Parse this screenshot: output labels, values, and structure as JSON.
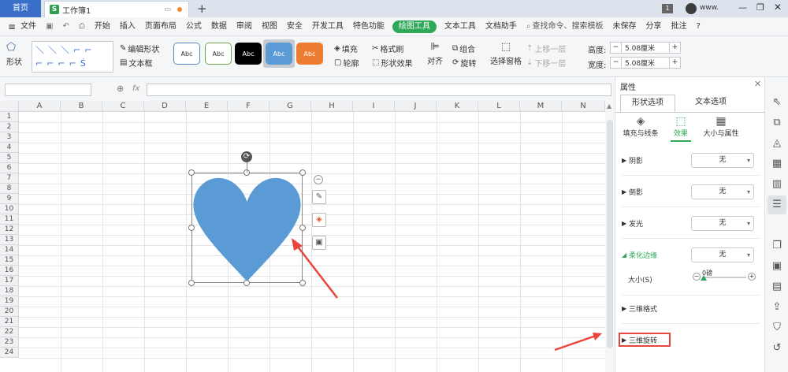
{
  "titlebar": {
    "home_tab": "首页",
    "doc_tab": "工作簿1",
    "doc_icon": "S",
    "page_badge": "1",
    "user": "www.",
    "new_tab": "+"
  },
  "menu": {
    "file": "文件",
    "items": [
      "开始",
      "插入",
      "页面布局",
      "公式",
      "数据",
      "审阅",
      "视图",
      "安全",
      "开发工具",
      "特色功能"
    ],
    "active": "绘图工具",
    "items2": [
      "文本工具",
      "文档助手"
    ],
    "search": "查找命令、搜索模板",
    "unsaved": "未保存",
    "share": "分享",
    "comment": "批注"
  },
  "ribbon": {
    "shape_label": "形状",
    "edit_shape": "编辑形状",
    "textbox": "文本框",
    "styles": [
      "Abc",
      "Abc",
      "Abc",
      "Abc",
      "Abc"
    ],
    "fill": "填充",
    "format_brush": "格式刷",
    "outline": "轮廓",
    "shape_effect": "形状效果",
    "align": "对齐",
    "group": "组合",
    "rotate": "旋转",
    "select_pane": "选择窗格",
    "up_layer": "上移一层",
    "down_layer": "下移一层",
    "height_label": "高度:",
    "height_value": "5.08厘米",
    "width_label": "宽度:",
    "width_value": "5.08厘米"
  },
  "formula": {
    "fx": "fx"
  },
  "sheet": {
    "columns": [
      "A",
      "B",
      "C",
      "D",
      "E",
      "F",
      "G",
      "H",
      "I",
      "J",
      "K",
      "L",
      "M",
      "N"
    ],
    "rows": [
      "1",
      "2",
      "3",
      "4",
      "5",
      "6",
      "7",
      "8",
      "9",
      "10",
      "11",
      "12",
      "13",
      "14",
      "15",
      "16",
      "17",
      "18",
      "19",
      "20",
      "21",
      "22",
      "23",
      "24"
    ]
  },
  "panel": {
    "title": "属性",
    "tab_shape": "形状选项",
    "tab_text": "文本选项",
    "sub_fill": "填充与线条",
    "sub_effect": "效果",
    "sub_size": "大小与属性",
    "shadow": "阴影",
    "reflection": "倒影",
    "glow": "发光",
    "soft_edge": "柔化边缘",
    "size_label": "大小(S)",
    "slider_value": "0磅",
    "format3d": "三维格式",
    "rotation3d": "三维旋转",
    "none": "无"
  },
  "colors": {
    "accent": "#2fa85a",
    "heart": "#5b9bd5",
    "arrow": "#e8453c",
    "home_tab": "#3a6fc8"
  }
}
